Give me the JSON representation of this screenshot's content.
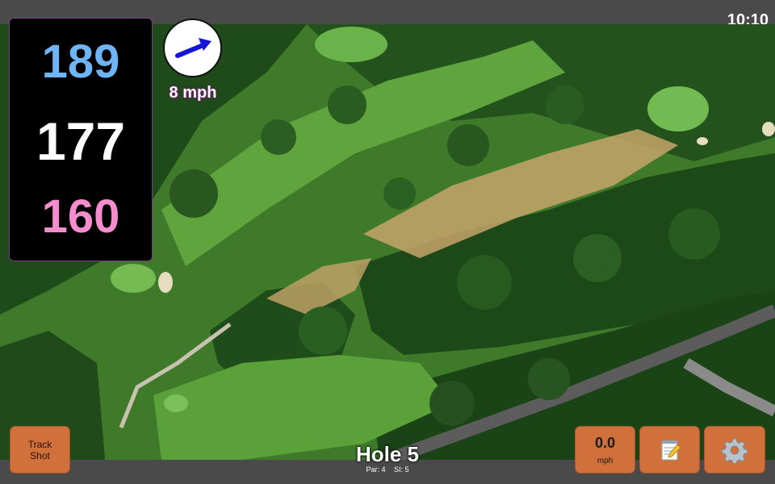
{
  "status_bar": {
    "time": "10:10"
  },
  "yardages": {
    "back": "189",
    "middle": "177",
    "front": "160"
  },
  "wind": {
    "speed_label": "8 mph",
    "direction_icon": "wind-arrow-icon"
  },
  "buttons": {
    "track_shot_line1": "Track",
    "track_shot_line2": "Shot",
    "speed_value": "0.0",
    "speed_unit": "mph",
    "notes_icon": "notepad-icon",
    "settings_icon": "gear-icon"
  },
  "hole": {
    "title": "Hole 5",
    "par": "Par: 4",
    "stroke_index": "SI: 5"
  },
  "colors": {
    "back_yardage": "#6fb4f5",
    "middle_yardage": "#ffffff",
    "front_yardage": "#f58ccd",
    "button_fill": "#d0703a",
    "wind_arrow": "#1414d8"
  }
}
